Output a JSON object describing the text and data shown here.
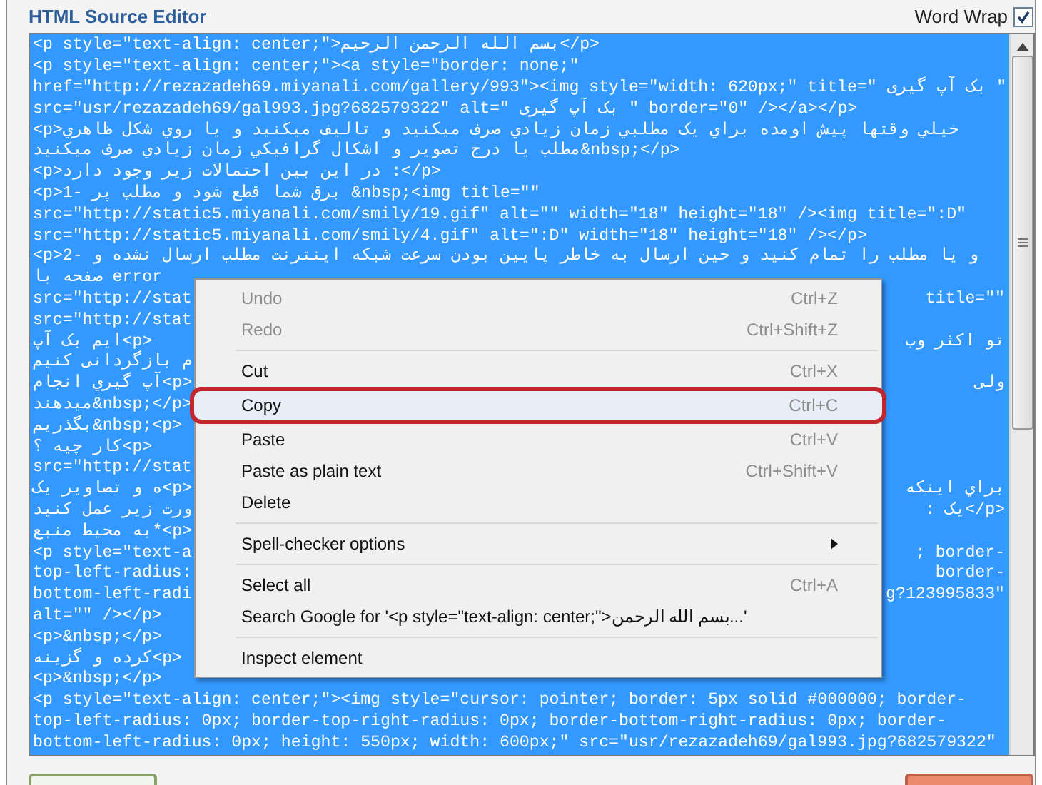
{
  "editor": {
    "title": "HTML Source Editor",
    "word_wrap": {
      "label": "Word Wrap",
      "checked": true
    },
    "lines": [
      {
        "text": "<p style=\"text-align: center;\">بسم الله الرحمن الرحیم</p>"
      },
      {
        "text": "<p style=\"text-align: center;\"><a style=\"border: none;\""
      },
      {
        "text": "href=\"http://rezazadeh69.miyanali.com/gallery/993\"><img style=\"width: 620px;\" title=\" بک آپ گیری \""
      },
      {
        "text": "src=\"usr/rezazadeh69/gal993.jpg?682579322\" alt=\" بک آپ گیری \" border=\"0\" /></a></p>"
      },
      {
        "text": "<p>خیلي وقتها پیش اومده براي یک مطلبي زمان زیادي صرف میکنید و تالیف میکنید و یا روي شکل ظاهري"
      },
      {
        "text": "مطلب یا درج تصویر و اشکال گرافیکي زمان زیادي صرف میکنید&nbsp;</p>"
      },
      {
        "text": "<p>در این بین احتمالات زیر وجود دارد :</p>"
      },
      {
        "text": "<p>1- برق شما قطع شود و مطلب پر &nbsp;<img title=\"\""
      },
      {
        "text": "src=\"http://static5.miyanali.com/smily/19.gif\" alt=\"\" width=\"18\" height=\"18\" /><img title=\":D\""
      },
      {
        "text": "src=\"http://static5.miyanali.com/smily/4.gif\" alt=\":D\" width=\"18\" height=\"18\" /></p>"
      },
      {
        "text": "<p>2- و یا مطلب را تمام کنید و حین ارسال به خاطر پایین بودن سرعت شبکه اینترنت مطلب ارسال نشده و"
      },
      {
        "text": "صفحه با error"
      },
      {
        "text": "src=\"http://stat",
        "right": "title=\"\""
      },
      {
        "text": "src=\"http://stat"
      },
      {
        "text": "ایم بک آپ<p>",
        "right": "تو اکثر وب"
      },
      {
        "text": "م بازگردانی کنیم"
      },
      {
        "text": "آپ گیري انجام<p>",
        "right": "ولی"
      },
      {
        "text": "میدهند&nbsp;</p>"
      },
      {
        "text": "بگذریم&nbsp;<p>"
      },
      {
        "text": "کار چیه ؟<p>"
      },
      {
        "text": "src=\"http://stat"
      },
      {
        "text": "ه و تصاویر یک<p>",
        "right": "براي اینکه"
      },
      {
        "text": "ورت زیر عمل کنید",
        "right": ": یک</p>"
      },
      {
        "text": "به محیط منبع*<p>"
      },
      {
        "text": "<p style=\"text-a",
        "right": "; border-"
      },
      {
        "text": "top-left-radius:",
        "right": "border-"
      },
      {
        "text": "bottom-left-radi",
        "right": "g?123995833\""
      },
      {
        "text": "alt=\"\" /></p>"
      },
      {
        "text": "<p>&nbsp;</p>"
      },
      {
        "text": "کرده و گزینه<p>"
      },
      {
        "text": "<p>&nbsp;</p>"
      },
      {
        "text": "<p style=\"text-align: center;\"><img style=\"cursor: pointer; border: 5px solid #000000; border-"
      },
      {
        "text": "top-left-radius: 0px; border-top-right-radius: 0px; border-bottom-right-radius: 0px; border-"
      },
      {
        "text": "bottom-left-radius: 0px; height: 550px; width: 600px;\" src=\"usr/rezazadeh69/gal993.jpg?682579322\""
      }
    ]
  },
  "context_menu": {
    "items": [
      {
        "kind": "item",
        "label": "Undo",
        "shortcut": "Ctrl+Z",
        "disabled": true,
        "selected": false
      },
      {
        "kind": "item",
        "label": "Redo",
        "shortcut": "Ctrl+Shift+Z",
        "disabled": true,
        "selected": false
      },
      {
        "kind": "separator"
      },
      {
        "kind": "item",
        "label": "Cut",
        "shortcut": "Ctrl+X",
        "disabled": false,
        "selected": false
      },
      {
        "kind": "item",
        "label": "Copy",
        "shortcut": "Ctrl+C",
        "disabled": false,
        "selected": true
      },
      {
        "kind": "item",
        "label": "Paste",
        "shortcut": "Ctrl+V",
        "disabled": false,
        "selected": false
      },
      {
        "kind": "item",
        "label": "Paste as plain text",
        "shortcut": "Ctrl+Shift+V",
        "disabled": false,
        "selected": false
      },
      {
        "kind": "item",
        "label": "Delete",
        "disabled": false,
        "selected": false
      },
      {
        "kind": "separator"
      },
      {
        "kind": "submenu",
        "label": "Spell-checker options",
        "disabled": false,
        "selected": false
      },
      {
        "kind": "separator"
      },
      {
        "kind": "item",
        "label": "Select all",
        "shortcut": "Ctrl+A",
        "disabled": false,
        "selected": false
      },
      {
        "kind": "item",
        "label": "Search Google for '<p style=\"text-align: center;\">بسم الله الرحمن...'",
        "disabled": false,
        "selected": false
      },
      {
        "kind": "separator"
      },
      {
        "kind": "item",
        "label": "Inspect element",
        "disabled": false,
        "selected": false
      }
    ]
  }
}
